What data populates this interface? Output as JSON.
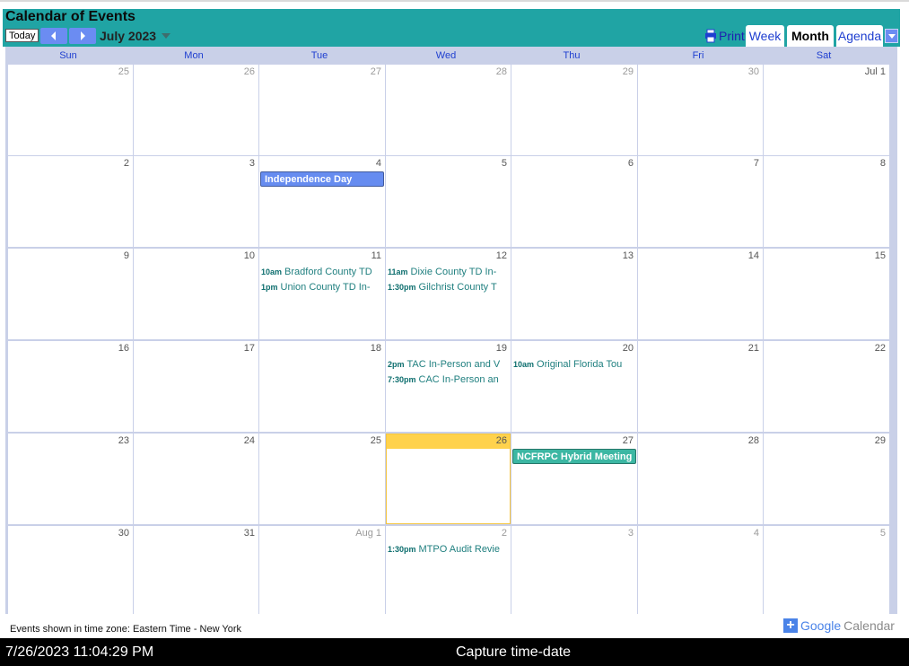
{
  "calendar": {
    "title": "Calendar of Events",
    "today_label": "Today",
    "month_label": "July 2023",
    "print_label": "Print",
    "tabs": [
      {
        "label": "Week",
        "active": false
      },
      {
        "label": "Month",
        "active": true
      },
      {
        "label": "Agenda",
        "active": false
      }
    ],
    "day_names": [
      "Sun",
      "Mon",
      "Tue",
      "Wed",
      "Thu",
      "Fri",
      "Sat"
    ],
    "weeks": [
      [
        {
          "label": "25",
          "other": true
        },
        {
          "label": "26",
          "other": true
        },
        {
          "label": "27",
          "other": true
        },
        {
          "label": "28",
          "other": true
        },
        {
          "label": "29",
          "other": true
        },
        {
          "label": "30",
          "other": true
        },
        {
          "label": "Jul 1",
          "other": false
        }
      ],
      [
        {
          "label": "2",
          "other": false
        },
        {
          "label": "3",
          "other": false
        },
        {
          "label": "4",
          "other": false
        },
        {
          "label": "5",
          "other": false
        },
        {
          "label": "6",
          "other": false
        },
        {
          "label": "7",
          "other": false
        },
        {
          "label": "8",
          "other": false
        }
      ],
      [
        {
          "label": "9",
          "other": false
        },
        {
          "label": "10",
          "other": false
        },
        {
          "label": "11",
          "other": false
        },
        {
          "label": "12",
          "other": false
        },
        {
          "label": "13",
          "other": false
        },
        {
          "label": "14",
          "other": false
        },
        {
          "label": "15",
          "other": false
        }
      ],
      [
        {
          "label": "16",
          "other": false
        },
        {
          "label": "17",
          "other": false
        },
        {
          "label": "18",
          "other": false
        },
        {
          "label": "19",
          "other": false
        },
        {
          "label": "20",
          "other": false
        },
        {
          "label": "21",
          "other": false
        },
        {
          "label": "22",
          "other": false
        }
      ],
      [
        {
          "label": "23",
          "other": false
        },
        {
          "label": "24",
          "other": false
        },
        {
          "label": "25",
          "other": false
        },
        {
          "label": "26",
          "other": false,
          "today": true
        },
        {
          "label": "27",
          "other": false
        },
        {
          "label": "28",
          "other": false
        },
        {
          "label": "29",
          "other": false
        }
      ],
      [
        {
          "label": "30",
          "other": false
        },
        {
          "label": "31",
          "other": false
        },
        {
          "label": "Aug 1",
          "other": true
        },
        {
          "label": "2",
          "other": true
        },
        {
          "label": "3",
          "other": true
        },
        {
          "label": "4",
          "other": true
        },
        {
          "label": "5",
          "other": true
        }
      ]
    ],
    "events": [
      {
        "week": 1,
        "day": 2,
        "row": 0,
        "allday": true,
        "title": "Independence Day",
        "color": "#668cf0"
      },
      {
        "week": 2,
        "day": 2,
        "row": 0,
        "time": "10am",
        "title": "Bradford County TD"
      },
      {
        "week": 2,
        "day": 2,
        "row": 1,
        "time": "1pm",
        "title": "Union County TD In-"
      },
      {
        "week": 2,
        "day": 3,
        "row": 0,
        "time": "11am",
        "title": "Dixie County TD In-"
      },
      {
        "week": 2,
        "day": 3,
        "row": 1,
        "time": "1:30pm",
        "title": "Gilchrist County T"
      },
      {
        "week": 3,
        "day": 3,
        "row": 0,
        "time": "2pm",
        "title": "TAC In-Person and V"
      },
      {
        "week": 3,
        "day": 3,
        "row": 1,
        "time": "7:30pm",
        "title": "CAC In-Person an"
      },
      {
        "week": 3,
        "day": 4,
        "row": 0,
        "time": "10am",
        "title": "Original Florida Tou"
      },
      {
        "week": 4,
        "day": 4,
        "row": 0,
        "allday": true,
        "title": "NCFRPC Hybrid Meeting",
        "color": "#3cb7a3"
      },
      {
        "week": 5,
        "day": 3,
        "row": 0,
        "time": "1:30pm",
        "title": "MTPO Audit Revie"
      }
    ],
    "timezone_note": "Events shown in time zone: Eastern Time - New York",
    "google_calendar": {
      "google": "Google",
      "calendar": "Calendar"
    },
    "colors": {
      "header": "#20a4a4",
      "today": "#ffd24c",
      "accent": "#6b8cf2"
    }
  },
  "capture_bar": {
    "timestamp": "7/26/2023 11:04:29 PM",
    "label": "Capture time-date"
  }
}
